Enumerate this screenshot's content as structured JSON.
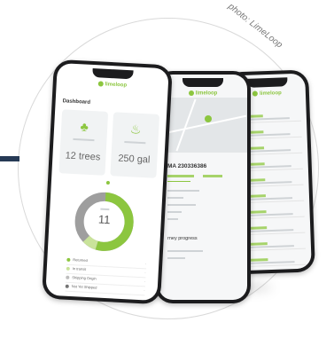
{
  "credit": "photo: LimeLoop",
  "colors": {
    "accent": "#8cc63f",
    "dark_accent": "#263a55",
    "phone": "#1c1c1e"
  },
  "phone1": {
    "brand": "limeloop",
    "heading": "Dashboard",
    "cards": [
      {
        "icon": "tree-icon",
        "value": "12 trees"
      },
      {
        "icon": "water-drop-icon",
        "value": "250 gal"
      }
    ],
    "donut_value": "11",
    "legend": [
      "Returned",
      "In transit",
      "Shipping Origin",
      "Not Yet Shipped"
    ]
  },
  "phone2": {
    "brand": "limeloop",
    "shipment_id": "MA 230336386",
    "journey_title": "rney progress"
  },
  "phone3": {
    "brand": "limeloop"
  }
}
